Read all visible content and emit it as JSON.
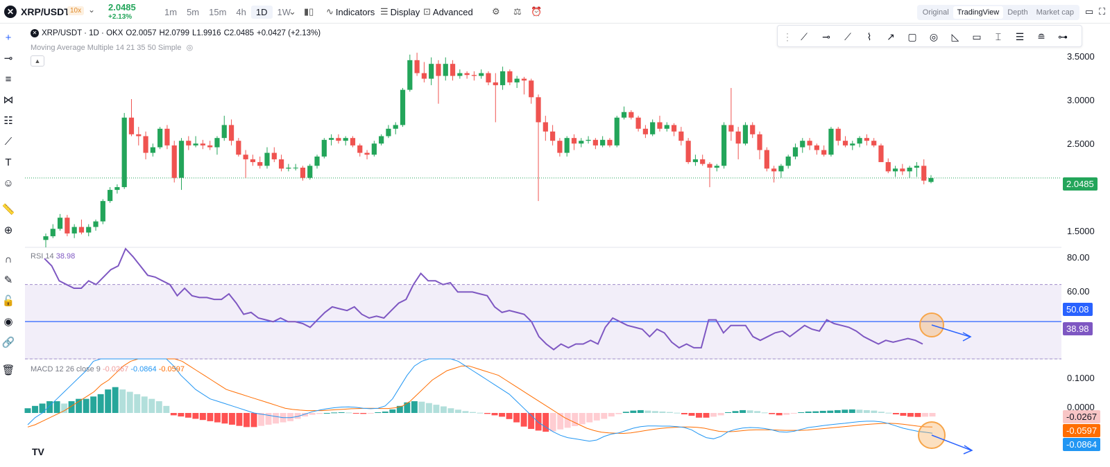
{
  "header": {
    "pair": "XRP/USDT",
    "leverage": "10x",
    "last_price": "2.0485",
    "change_pct": "+2.13%",
    "intervals": [
      "1m",
      "5m",
      "15m",
      "4h",
      "1D",
      "1W"
    ],
    "active_interval": "1D",
    "indicators_label": "Indicators",
    "display_label": "Display",
    "advanced_label": "Advanced",
    "views": [
      "Original",
      "TradingView",
      "Depth",
      "Market cap"
    ],
    "active_view": "TradingView"
  },
  "legend": {
    "symbol": "XRP/USDT · 1D · OKX",
    "open": "O2.0057",
    "high": "H2.0799",
    "low": "L1.9916",
    "close": "C2.0485",
    "change": "+0.0427 (+2.13%)",
    "ma": "Moving Average Multiple 14 21 35 50 Simple"
  },
  "price_axis": [
    "3.5000",
    "3.0000",
    "2.5000",
    "1.5000"
  ],
  "price_badge": "2.0485",
  "rsi": {
    "label": "RSI 14",
    "value": "38.98",
    "axis": [
      "80.00",
      "60.00"
    ],
    "ma_badge": "50.08",
    "value_badge": "38.98"
  },
  "macd": {
    "label": "MACD 12 26 close 9",
    "hist": "-0.0267",
    "macd": "-0.0864",
    "signal": "-0.0597",
    "axis": [
      "0.1000",
      "0.0000"
    ],
    "badge_hist": "-0.0267",
    "badge_signal": "-0.0597",
    "badge_macd": "-0.0864"
  },
  "colors": {
    "up": "#26a69a",
    "up_candle": "#23a55a",
    "down": "#ef5350",
    "rsi": "#7e57c2",
    "macd": "#2196f3",
    "signal": "#ff6d00",
    "highlight": "#f7a54a"
  },
  "chart_data": {
    "type": "candlestick",
    "price_ylim": [
      1.3,
      3.7
    ],
    "candles": [
      [
        1.38,
        1.45,
        1.3,
        1.42
      ],
      [
        1.42,
        1.55,
        1.4,
        1.5
      ],
      [
        1.5,
        1.66,
        1.48,
        1.62
      ],
      [
        1.62,
        1.65,
        1.42,
        1.45
      ],
      [
        1.45,
        1.55,
        1.4,
        1.52
      ],
      [
        1.52,
        1.6,
        1.44,
        1.46
      ],
      [
        1.46,
        1.55,
        1.42,
        1.52
      ],
      [
        1.52,
        1.6,
        1.48,
        1.58
      ],
      [
        1.58,
        1.82,
        1.55,
        1.8
      ],
      [
        1.8,
        1.95,
        1.78,
        1.92
      ],
      [
        1.92,
        1.98,
        1.88,
        1.95
      ],
      [
        1.95,
        2.75,
        1.93,
        2.7
      ],
      [
        2.7,
        2.9,
        2.5,
        2.52
      ],
      [
        2.52,
        2.6,
        2.4,
        2.5
      ],
      [
        2.5,
        2.55,
        2.25,
        2.32
      ],
      [
        2.32,
        2.42,
        2.28,
        2.38
      ],
      [
        2.38,
        2.6,
        2.36,
        2.58
      ],
      [
        2.58,
        2.62,
        2.36,
        2.4
      ],
      [
        2.4,
        2.45,
        2.0,
        2.05
      ],
      [
        2.05,
        2.48,
        1.92,
        2.45
      ],
      [
        2.45,
        2.5,
        2.35,
        2.4
      ],
      [
        2.4,
        2.5,
        2.38,
        2.42
      ],
      [
        2.42,
        2.46,
        2.36,
        2.4
      ],
      [
        2.4,
        2.45,
        2.35,
        2.38
      ],
      [
        2.38,
        2.5,
        2.3,
        2.48
      ],
      [
        2.48,
        2.72,
        2.45,
        2.62
      ],
      [
        2.62,
        2.68,
        2.4,
        2.45
      ],
      [
        2.45,
        2.48,
        2.28,
        2.3
      ],
      [
        2.3,
        2.35,
        2.05,
        2.25
      ],
      [
        2.25,
        2.3,
        2.18,
        2.22
      ],
      [
        2.22,
        2.28,
        2.15,
        2.18
      ],
      [
        2.18,
        2.38,
        2.15,
        2.32
      ],
      [
        2.32,
        2.38,
        2.22,
        2.25
      ],
      [
        2.25,
        2.3,
        2.12,
        2.15
      ],
      [
        2.15,
        2.2,
        2.12,
        2.16
      ],
      [
        2.16,
        2.2,
        2.13,
        2.16
      ],
      [
        2.16,
        2.18,
        2.02,
        2.05
      ],
      [
        2.05,
        2.2,
        2.03,
        2.18
      ],
      [
        2.18,
        2.3,
        2.15,
        2.28
      ],
      [
        2.28,
        2.48,
        2.26,
        2.46
      ],
      [
        2.46,
        2.52,
        2.4,
        2.48
      ],
      [
        2.48,
        2.52,
        2.42,
        2.45
      ],
      [
        2.45,
        2.5,
        2.4,
        2.48
      ],
      [
        2.48,
        2.5,
        2.38,
        2.4
      ],
      [
        2.4,
        2.42,
        2.28,
        2.32
      ],
      [
        2.32,
        2.35,
        2.25,
        2.3
      ],
      [
        2.3,
        2.45,
        2.28,
        2.42
      ],
      [
        2.42,
        2.52,
        2.4,
        2.5
      ],
      [
        2.5,
        2.62,
        2.48,
        2.58
      ],
      [
        2.58,
        2.65,
        2.52,
        2.62
      ],
      [
        2.62,
        3.02,
        2.6,
        3.0
      ],
      [
        3.0,
        3.38,
        2.98,
        3.32
      ],
      [
        3.32,
        3.4,
        3.15,
        3.18
      ],
      [
        3.18,
        3.3,
        3.08,
        3.12
      ],
      [
        3.12,
        3.35,
        3.05,
        3.28
      ],
      [
        3.28,
        3.32,
        2.85,
        3.15
      ],
      [
        3.15,
        3.35,
        3.1,
        3.28
      ],
      [
        3.28,
        3.32,
        3.1,
        3.15
      ],
      [
        3.15,
        3.22,
        3.12,
        3.18
      ],
      [
        3.18,
        3.2,
        3.12,
        3.16
      ],
      [
        3.16,
        3.2,
        3.1,
        3.15
      ],
      [
        3.15,
        3.22,
        3.12,
        3.18
      ],
      [
        3.18,
        3.2,
        3.05,
        3.08
      ],
      [
        3.08,
        3.18,
        2.65,
        3.05
      ],
      [
        3.05,
        3.25,
        3.0,
        3.2
      ],
      [
        3.2,
        3.22,
        3.05,
        3.08
      ],
      [
        3.08,
        3.15,
        3.02,
        3.12
      ],
      [
        3.12,
        3.14,
        2.95,
        3.1
      ],
      [
        3.1,
        3.12,
        2.85,
        2.92
      ],
      [
        2.92,
        2.95,
        1.8,
        2.65
      ],
      [
        2.65,
        2.72,
        2.45,
        2.55
      ],
      [
        2.55,
        2.62,
        2.4,
        2.45
      ],
      [
        2.45,
        2.48,
        2.28,
        2.32
      ],
      [
        2.32,
        2.5,
        2.28,
        2.48
      ],
      [
        2.48,
        2.52,
        2.35,
        2.42
      ],
      [
        2.42,
        2.48,
        2.38,
        2.45
      ],
      [
        2.45,
        2.5,
        2.42,
        2.46
      ],
      [
        2.46,
        2.48,
        2.36,
        2.4
      ],
      [
        2.4,
        2.5,
        2.38,
        2.46
      ],
      [
        2.46,
        2.48,
        2.38,
        2.4
      ],
      [
        2.4,
        2.72,
        2.38,
        2.7
      ],
      [
        2.7,
        2.82,
        2.68,
        2.76
      ],
      [
        2.76,
        2.78,
        2.68,
        2.7
      ],
      [
        2.7,
        2.72,
        2.55,
        2.58
      ],
      [
        2.58,
        2.62,
        2.48,
        2.52
      ],
      [
        2.52,
        2.68,
        2.5,
        2.65
      ],
      [
        2.65,
        2.72,
        2.55,
        2.58
      ],
      [
        2.58,
        2.65,
        2.55,
        2.62
      ],
      [
        2.62,
        2.64,
        2.5,
        2.55
      ],
      [
        2.55,
        2.6,
        2.4,
        2.45
      ],
      [
        2.45,
        2.48,
        2.2,
        2.22
      ],
      [
        2.22,
        2.3,
        2.18,
        2.25
      ],
      [
        2.25,
        2.3,
        2.18,
        2.2
      ],
      [
        2.2,
        2.22,
        1.95,
        2.16
      ],
      [
        2.16,
        2.2,
        2.12,
        2.18
      ],
      [
        2.18,
        2.65,
        2.15,
        2.62
      ],
      [
        2.62,
        3.02,
        2.45,
        2.55
      ],
      [
        2.55,
        2.6,
        2.25,
        2.42
      ],
      [
        2.42,
        2.65,
        2.4,
        2.62
      ],
      [
        2.62,
        2.65,
        2.48,
        2.52
      ],
      [
        2.52,
        2.55,
        2.25,
        2.35
      ],
      [
        2.35,
        2.38,
        2.12,
        2.15
      ],
      [
        2.15,
        2.18,
        2.0,
        2.12
      ],
      [
        2.12,
        2.2,
        2.05,
        2.18
      ],
      [
        2.18,
        2.3,
        2.15,
        2.28
      ],
      [
        2.28,
        2.42,
        2.25,
        2.38
      ],
      [
        2.38,
        2.48,
        2.32,
        2.45
      ],
      [
        2.45,
        2.48,
        2.35,
        2.4
      ],
      [
        2.4,
        2.42,
        2.3,
        2.35
      ],
      [
        2.35,
        2.4,
        2.28,
        2.3
      ],
      [
        2.3,
        2.6,
        2.28,
        2.58
      ],
      [
        2.58,
        2.6,
        2.4,
        2.45
      ],
      [
        2.45,
        2.5,
        2.38,
        2.4
      ],
      [
        2.4,
        2.45,
        2.35,
        2.42
      ],
      [
        2.42,
        2.5,
        2.38,
        2.48
      ],
      [
        2.48,
        2.52,
        2.4,
        2.45
      ],
      [
        2.45,
        2.48,
        2.38,
        2.4
      ],
      [
        2.4,
        2.42,
        2.28,
        2.22
      ],
      [
        2.22,
        2.26,
        2.1,
        2.12
      ],
      [
        2.12,
        2.18,
        2.06,
        2.15
      ],
      [
        2.15,
        2.2,
        2.08,
        2.12
      ],
      [
        2.12,
        2.18,
        2.05,
        2.16
      ],
      [
        2.16,
        2.22,
        2.06,
        2.18
      ],
      [
        2.18,
        2.25,
        1.98,
        2.02
      ],
      [
        2.0057,
        2.0799,
        1.9916,
        2.0485
      ]
    ],
    "rsi": [
      84,
      80,
      72,
      70,
      68,
      68,
      72,
      70,
      74,
      78,
      80,
      90,
      85,
      80,
      75,
      74,
      72,
      70,
      64,
      68,
      64,
      63,
      63,
      62,
      62,
      65,
      60,
      54,
      55,
      52,
      51,
      50,
      52,
      50,
      50,
      49,
      47,
      51,
      55,
      58,
      57,
      56,
      58,
      54,
      52,
      53,
      52,
      56,
      60,
      62,
      70,
      76,
      72,
      72,
      70,
      71,
      66,
      66,
      66,
      65,
      64,
      58,
      55,
      56,
      55,
      54,
      50,
      42,
      38,
      35,
      38,
      36,
      38,
      38,
      40,
      38,
      47,
      52,
      50,
      48,
      47,
      46,
      42,
      46,
      44,
      39,
      36,
      38,
      36,
      36,
      51,
      51,
      44,
      48,
      48,
      48,
      42,
      40,
      42,
      44,
      45,
      42,
      45,
      48,
      46,
      45,
      51,
      49,
      48,
      47,
      45,
      42,
      40,
      38,
      40,
      39,
      40,
      41,
      40,
      38
    ],
    "rsi_ylim": [
      30,
      90
    ],
    "rsi_levels": [
      70,
      50.08,
      30
    ],
    "macd_ylim": [
      -0.23,
      0.23
    ],
    "macd_hist": [
      0.02,
      0.03,
      0.04,
      0.05,
      0.05,
      0.04,
      0.05,
      0.06,
      0.06,
      0.07,
      0.08,
      0.1,
      0.11,
      0.1,
      0.09,
      0.08,
      0.07,
      0.06,
      0.05,
      0.03,
      -0.01,
      -0.015,
      -0.02,
      -0.025,
      -0.03,
      -0.035,
      -0.04,
      -0.045,
      -0.05,
      -0.055,
      -0.06,
      -0.06,
      -0.055,
      -0.05,
      -0.045,
      -0.04,
      -0.035,
      -0.025,
      -0.015,
      -0.008,
      -0.004,
      0,
      0.002,
      0.003,
      0.002,
      -0.002,
      -0.004,
      -0.002,
      0.003,
      0.006,
      0.015,
      0.03,
      0.045,
      0.05,
      0.048,
      0.042,
      0.035,
      0.028,
      0.02,
      0.014,
      0.008,
      0.004,
      0.001,
      -0.004,
      -0.01,
      -0.016,
      -0.026,
      -0.04,
      -0.058,
      -0.068,
      -0.075,
      -0.08,
      -0.078,
      -0.07,
      -0.063,
      -0.056,
      -0.048,
      -0.04,
      -0.032,
      -0.025,
      -0.015,
      -0.005,
      0.005,
      0.01,
      0.012,
      0.01,
      0.008,
      0.006,
      0.004,
      0.001,
      -0.006,
      -0.012,
      -0.02,
      -0.02,
      -0.016,
      -0.01,
      0.003,
      0.008,
      0.012,
      0.011,
      0.008,
      0.002,
      -0.005,
      -0.01,
      -0.008,
      -0.003,
      0.003,
      0.006,
      0.007,
      0.009,
      0.01,
      0.012,
      0.014,
      0.015,
      0.014,
      0.012,
      0.01,
      0.005,
      0.001,
      -0.006,
      -0.012,
      -0.016,
      -0.017,
      -0.016,
      -0.015
    ],
    "macd_line": [
      -0.05,
      -0.02,
      0.0,
      0.03,
      0.06,
      0.09,
      0.12,
      0.15,
      0.18,
      0.22,
      0.26,
      0.3,
      0.34,
      0.37,
      0.38,
      0.38,
      0.36,
      0.34,
      0.3,
      0.26,
      0.2,
      0.16,
      0.13,
      0.1,
      0.08,
      0.06,
      0.05,
      0.04,
      0.03,
      0.02,
      0.01,
      0.0,
      -0.005,
      -0.01,
      -0.015,
      -0.02,
      -0.02,
      -0.015,
      -0.005,
      0.005,
      0.012,
      0.018,
      0.022,
      0.025,
      0.026,
      0.024,
      0.02,
      0.018,
      0.02,
      0.03,
      0.06,
      0.11,
      0.16,
      0.2,
      0.22,
      0.23,
      0.235,
      0.235,
      0.23,
      0.22,
      0.2,
      0.18,
      0.16,
      0.14,
      0.12,
      0.1,
      0.08,
      0.05,
      0.02,
      -0.01,
      -0.04,
      -0.06,
      -0.08,
      -0.095,
      -0.105,
      -0.11,
      -0.115,
      -0.12,
      -0.115,
      -0.1,
      -0.09,
      -0.085,
      -0.075,
      -0.065,
      -0.058,
      -0.055,
      -0.055,
      -0.056,
      -0.056,
      -0.058,
      -0.062,
      -0.072,
      -0.09,
      -0.105,
      -0.11,
      -0.1,
      -0.08,
      -0.07,
      -0.064,
      -0.062,
      -0.063,
      -0.066,
      -0.072,
      -0.08,
      -0.082,
      -0.078,
      -0.07,
      -0.062,
      -0.058,
      -0.054,
      -0.05,
      -0.047,
      -0.044,
      -0.04,
      -0.037,
      -0.035,
      -0.035,
      -0.038,
      -0.045,
      -0.055,
      -0.065,
      -0.072,
      -0.078,
      -0.082,
      -0.0864
    ],
    "signal_line": [
      -0.06,
      -0.05,
      -0.035,
      -0.02,
      -0.005,
      0.01,
      0.03,
      0.05,
      0.07,
      0.09,
      0.12,
      0.14,
      0.17,
      0.2,
      0.22,
      0.24,
      0.26,
      0.27,
      0.27,
      0.26,
      0.24,
      0.22,
      0.2,
      0.18,
      0.16,
      0.14,
      0.12,
      0.1,
      0.09,
      0.08,
      0.07,
      0.06,
      0.05,
      0.04,
      0.03,
      0.02,
      0.015,
      0.012,
      0.01,
      0.01,
      0.01,
      0.012,
      0.014,
      0.016,
      0.018,
      0.019,
      0.02,
      0.02,
      0.019,
      0.019,
      0.022,
      0.03,
      0.05,
      0.08,
      0.11,
      0.14,
      0.16,
      0.18,
      0.19,
      0.2,
      0.2,
      0.19,
      0.18,
      0.17,
      0.16,
      0.14,
      0.12,
      0.1,
      0.08,
      0.06,
      0.04,
      0.02,
      0.0,
      -0.02,
      -0.035,
      -0.05,
      -0.065,
      -0.075,
      -0.082,
      -0.085,
      -0.086,
      -0.087,
      -0.085,
      -0.08,
      -0.075,
      -0.07,
      -0.066,
      -0.063,
      -0.061,
      -0.06,
      -0.06,
      -0.061,
      -0.065,
      -0.072,
      -0.078,
      -0.08,
      -0.079,
      -0.076,
      -0.073,
      -0.072,
      -0.072,
      -0.072,
      -0.073,
      -0.074,
      -0.074,
      -0.074,
      -0.073,
      -0.07,
      -0.067,
      -0.064,
      -0.061,
      -0.058,
      -0.055,
      -0.052,
      -0.049,
      -0.047,
      -0.045,
      -0.044,
      -0.045,
      -0.048,
      -0.052,
      -0.056,
      -0.059,
      -0.0597
    ]
  }
}
